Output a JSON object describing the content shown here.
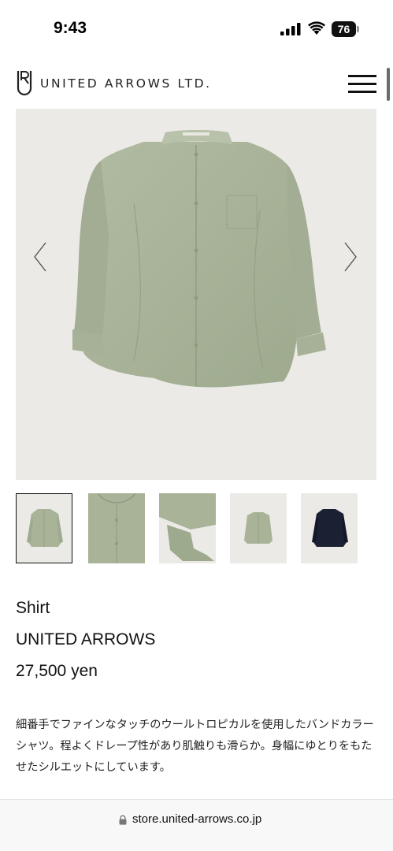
{
  "status_bar": {
    "time": "9:43",
    "battery": "76"
  },
  "header": {
    "logo_text": "UNITED ARROWS LTD."
  },
  "gallery": {
    "main_image": "green-band-collar-shirt",
    "thumbnails": [
      "shirt-front-green",
      "collar-detail-green",
      "cuff-hem-detail-green",
      "shirt-front-green-small",
      "shirt-front-navy"
    ],
    "active_thumbnail": 0,
    "colors": {
      "background": "#ebeae6",
      "shirt_green": "#a8b398",
      "shirt_navy": "#1c2033"
    }
  },
  "product": {
    "name": "Shirt",
    "brand": "UNITED ARROWS",
    "price": "27,500 yen",
    "description": "細番手でファインなタッチのウールトロピカルを使用したバンドカラーシャツ。程よくドレープ性があり肌触りも滑らか。身幅にゆとりをもたせたシルエットにしています。"
  },
  "browser": {
    "url": "store.united-arrows.co.jp"
  }
}
